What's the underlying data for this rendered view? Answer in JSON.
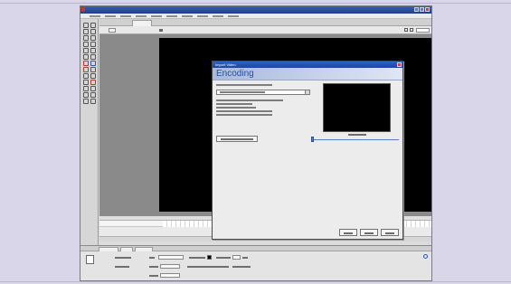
{
  "app": {
    "title": ""
  },
  "dialog": {
    "title": "Import Video",
    "heading": "Encoding"
  },
  "colors": {
    "page_background": "#d9d6ea",
    "dialog_titlebar": "#1c45a0",
    "dialog_heading": "#2c4f96",
    "stage": "#000000"
  }
}
